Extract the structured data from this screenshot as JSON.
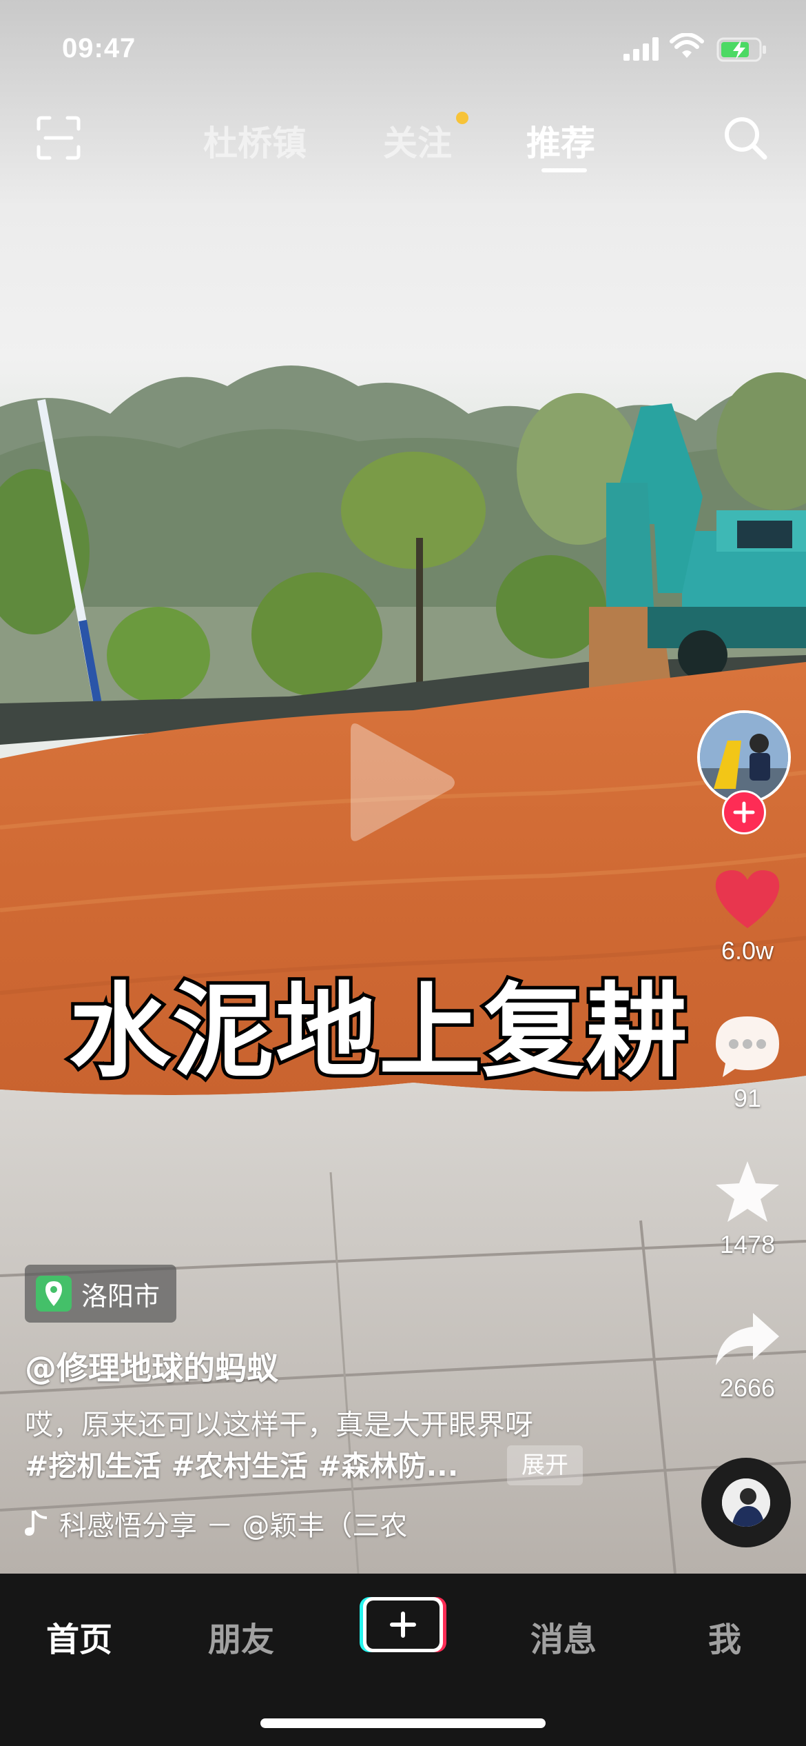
{
  "status_bar": {
    "time": "09:47"
  },
  "top_tabs": [
    {
      "label": "杜桥镇",
      "active": false
    },
    {
      "label": "关注",
      "active": false,
      "dot": true
    },
    {
      "label": "推荐",
      "active": true
    }
  ],
  "video": {
    "caption": "水泥地上复耕"
  },
  "actions": {
    "likes": "6.0w",
    "comments": "91",
    "favorites": "1478",
    "shares": "2666"
  },
  "location": "洛阳市",
  "author": "@修理地球的蚂蚁",
  "description": {
    "text": "哎，原来还可以这样干，真是大开眼界呀",
    "tags": "#挖机生活 #农村生活 #森林防...",
    "expand_label": "展开"
  },
  "music": "科感悟分享 － @颖丰（三农",
  "bottom_nav": {
    "home": "首页",
    "friends": "朋友",
    "messages": "消息",
    "me": "我"
  },
  "colors": {
    "accent_red": "#fe2c55",
    "heart_red": "#e8364e",
    "location_green": "#44c069",
    "tab_dot_yellow": "#f7c338"
  }
}
